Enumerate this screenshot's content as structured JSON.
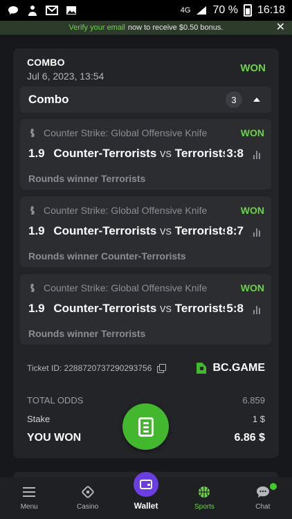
{
  "status_bar": {
    "network": "4G",
    "battery": "70 %",
    "time": "16:18"
  },
  "banner": {
    "verify_link": "Verify your email",
    "message": "now to receive $0.50 bonus.",
    "close": "✕"
  },
  "bet": {
    "type": "COMBO",
    "date": "Jul 6, 2023, 13:54",
    "status": "WON",
    "combo_label": "Combo",
    "leg_count": "3",
    "legs": [
      {
        "league": "Counter Strike: Global Offensive Knife",
        "status": "WON",
        "odds": "1.9",
        "home": "Counter-Terrorists",
        "vs": "vs",
        "away": "Terrorists",
        "score": "3:8",
        "market": "Rounds winner Terrorists"
      },
      {
        "league": "Counter Strike: Global Offensive Knife",
        "status": "WON",
        "odds": "1.9",
        "home": "Counter-Terrorists",
        "vs": "vs",
        "away": "Terrorists",
        "score": "8:7",
        "market": "Rounds winner Counter-Terrorists"
      },
      {
        "league": "Counter Strike: Global Offensive Knife",
        "status": "WON",
        "odds": "1.9",
        "home": "Counter-Terrorists",
        "vs": "vs",
        "away": "Terrorists",
        "score": "5:8",
        "market": "Rounds winner Terrorists"
      }
    ],
    "ticket_id": "Ticket ID: 2288720737290293756",
    "brand": "BC.GAME",
    "total_odds_label": "TOTAL ODDS",
    "total_odds": "6.859",
    "stake_label": "Stake",
    "stake": "1 $",
    "won_label": "YOU WON",
    "won_amount": "6.86 $"
  },
  "nav": {
    "menu": "Menu",
    "casino": "Casino",
    "wallet": "Wallet",
    "sports": "Sports",
    "chat": "Chat"
  },
  "colors": {
    "accent_green": "#6fd14b",
    "wallet_purple": "#6a3ee0",
    "fab_green": "#43b72d"
  }
}
